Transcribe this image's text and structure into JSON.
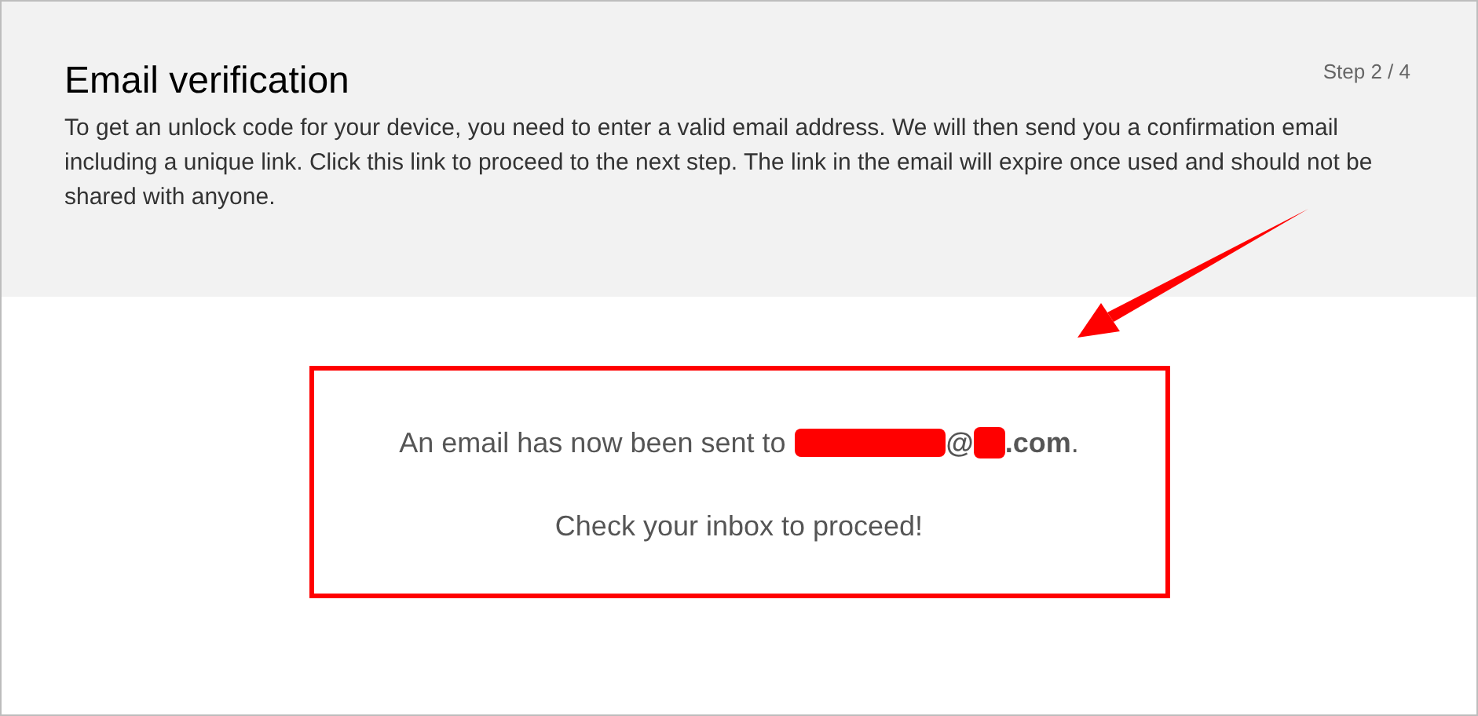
{
  "header": {
    "title": "Email verification",
    "step": "Step 2 / 4",
    "description": "To get an unlock code for your device, you need to enter a valid email address. We will then send you a confirmation email including a unique link. Click this link to proceed to the next step. The link in the email will expire once used and should not be shared with anyone."
  },
  "message": {
    "sent_prefix": "An email has now been sent to",
    "email_parts": [
      {
        "kind": "redacted"
      },
      {
        "kind": "text",
        "text": "@"
      },
      {
        "kind": "redacted"
      },
      {
        "kind": "text",
        "text": ".com"
      }
    ],
    "sent_suffix": ".",
    "instruction": "Check your inbox to proceed!"
  }
}
